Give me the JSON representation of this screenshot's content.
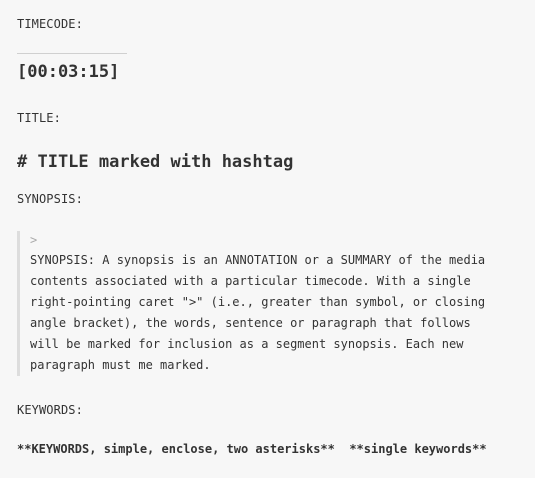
{
  "timecode": {
    "label": "TIMECODE:",
    "value": "[00:03:15]"
  },
  "title": {
    "label": "TITLE:",
    "value": "# TITLE marked with hashtag"
  },
  "synopsis": {
    "label": "SYNOPSIS:",
    "caret": ">",
    "lines": [
      "SYNOPSIS: A synopsis is an ANNOTATION or a SUMMARY of the media",
      "contents associated with a particular timecode. With a single",
      "right-pointing caret \">\" (i.e., greater than symbol, or closing",
      "angle bracket), the words, sentence or paragraph that follows",
      "will be marked for inclusion as a segment synopsis. Each new",
      "paragraph must me marked."
    ]
  },
  "keywords": {
    "label": "KEYWORDS:",
    "value": "**KEYWORDS, simple, enclose, two asterisks**  **single keywords**"
  }
}
